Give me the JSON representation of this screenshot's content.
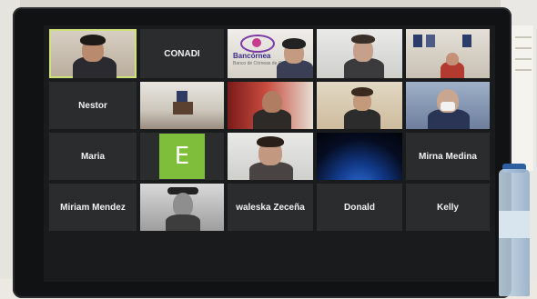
{
  "scene": {
    "description_kind": "photo of a computer monitor showing a video-meeting gallery view"
  },
  "meeting": {
    "tiles": [
      {
        "name": "",
        "kind": "video",
        "active": true
      },
      {
        "name": "CONADI",
        "kind": "name-only"
      },
      {
        "name": "",
        "kind": "video-logo",
        "logo_text": "Bancórnea",
        "logo_sub": "Banco de Córneas de Guate"
      },
      {
        "name": "",
        "kind": "video"
      },
      {
        "name": "",
        "kind": "video"
      },
      {
        "name": "Nestor",
        "kind": "name-only"
      },
      {
        "name": "",
        "kind": "video"
      },
      {
        "name": "",
        "kind": "video"
      },
      {
        "name": "",
        "kind": "video"
      },
      {
        "name": "",
        "kind": "video"
      },
      {
        "name": "Maria",
        "kind": "name-only"
      },
      {
        "name": "E",
        "kind": "avatar-letter"
      },
      {
        "name": "",
        "kind": "video"
      },
      {
        "name": "",
        "kind": "video"
      },
      {
        "name": "Mirna Medina",
        "kind": "name-only"
      },
      {
        "name": "Miriam Mendez",
        "kind": "name-only"
      },
      {
        "name": "",
        "kind": "video"
      },
      {
        "name": "waleska Zeceña",
        "kind": "name-only"
      },
      {
        "name": "Donald",
        "kind": "name-only"
      },
      {
        "name": "Kelly",
        "kind": "name-only"
      }
    ]
  }
}
